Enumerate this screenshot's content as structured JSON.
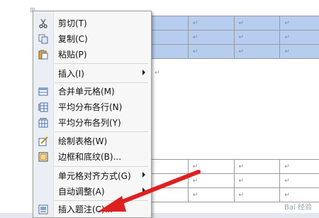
{
  "menu": {
    "items": [
      {
        "label": "剪切(T)",
        "icon": "scissors-icon"
      },
      {
        "label": "复制(C)",
        "icon": "copy-icon"
      },
      {
        "label": "粘贴(P)",
        "icon": "paste-icon"
      },
      {
        "label": "插入(I)",
        "icon": "",
        "submenu": true
      },
      {
        "label": "合并单元格(M)",
        "icon": "merge-cells-icon"
      },
      {
        "label": "平均分布各行(N)",
        "icon": "distribute-rows-icon"
      },
      {
        "label": "平均分布各列(Y)",
        "icon": "distribute-columns-icon"
      },
      {
        "label": "绘制表格(W)",
        "icon": "draw-table-icon"
      },
      {
        "label": "边框和底纹(B)...",
        "icon": "borders-icon"
      },
      {
        "label": "单元格对齐方式(G)",
        "icon": "",
        "submenu": true
      },
      {
        "label": "自动调整(A)",
        "icon": "",
        "submenu": true
      },
      {
        "label": "插入题注(C)...",
        "icon": "insert-caption-icon"
      }
    ]
  },
  "document": {
    "cell_mark": "↵"
  },
  "colors": {
    "selection": "#b7cdf0",
    "arrow": "#e02020"
  },
  "watermark": "Bai 经验"
}
